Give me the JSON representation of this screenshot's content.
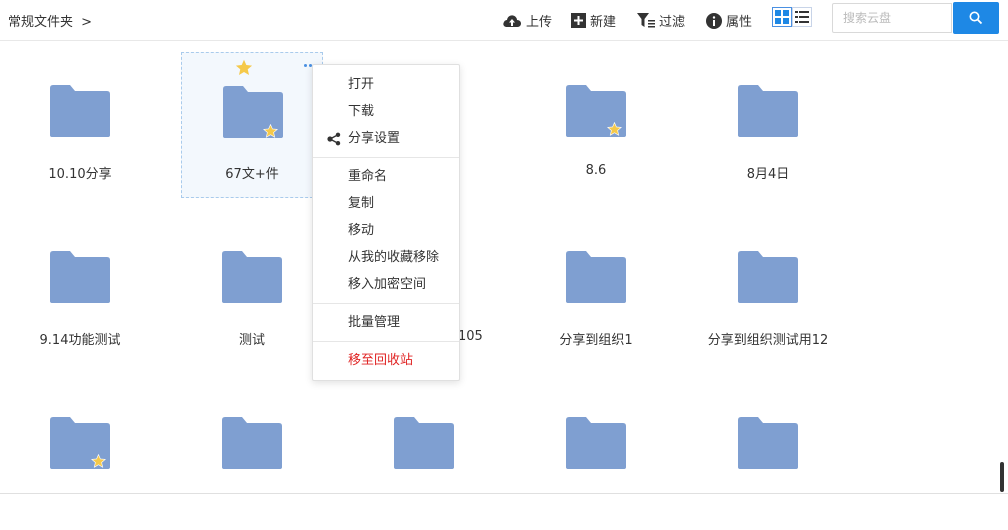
{
  "breadcrumb": {
    "label": "常规文件夹",
    "separator": ">"
  },
  "toolbar": {
    "upload": "上传",
    "new": "新建",
    "filter": "过滤",
    "properties": "属性"
  },
  "search": {
    "placeholder": "搜索云盘",
    "value": ""
  },
  "colors": {
    "accent": "#1e88e5",
    "folder": "#7f9fd1",
    "star": "#f5c94a",
    "danger": "#e02424"
  },
  "folders": [
    {
      "name": "10.10分享",
      "starred": false
    },
    {
      "name": "67文+件",
      "starred": true,
      "selected": true
    },
    {
      "name": "8.6",
      "starred": true
    },
    {
      "name": "8月4日",
      "starred": false
    },
    {
      "name": "9.14功能测试",
      "starred": false
    },
    {
      "name": "测试",
      "starred": false
    },
    {
      "name": "105",
      "starred": false
    },
    {
      "name": "分享到组织1",
      "starred": false
    },
    {
      "name": "分享到组织测试用12",
      "starred": false
    },
    {
      "name": "",
      "starred": true
    },
    {
      "name": "",
      "starred": false
    },
    {
      "name": "",
      "starred": false
    },
    {
      "name": "",
      "starred": false
    },
    {
      "name": "",
      "starred": false
    }
  ],
  "context_menu": {
    "open": "打开",
    "download": "下载",
    "share_settings": "分享设置",
    "rename": "重命名",
    "copy": "复制",
    "move": "移动",
    "remove_from_favorites": "从我的收藏移除",
    "move_to_private": "移入加密空间",
    "batch_manage": "批量管理",
    "move_to_trash": "移至回收站"
  }
}
